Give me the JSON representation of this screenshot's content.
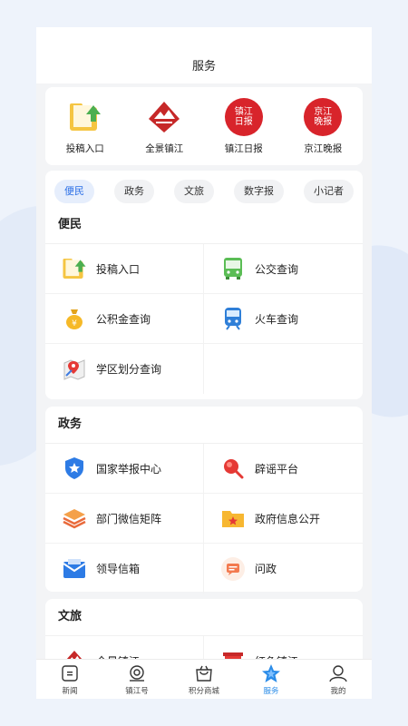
{
  "header": {
    "title": "服务"
  },
  "quick_links": [
    {
      "label": "投稿入口",
      "icon": "folder-upload-icon"
    },
    {
      "label": "全景镇江",
      "icon": "panorama-logo-icon"
    },
    {
      "label": "镇江日报",
      "icon": "zhenjiang-daily-logo",
      "logo_text": "镇江日报"
    },
    {
      "label": "京江晚报",
      "icon": "jingjiang-evening-logo",
      "logo_text": "京江晚报"
    }
  ],
  "filters": [
    {
      "label": "便民",
      "active": true
    },
    {
      "label": "政务",
      "active": false
    },
    {
      "label": "文旅",
      "active": false
    },
    {
      "label": "数字报",
      "active": false
    },
    {
      "label": "小记者",
      "active": false
    }
  ],
  "sections": {
    "bianmin": {
      "title": "便民",
      "items": [
        {
          "label": "投稿入口",
          "icon": "folder-upload-icon"
        },
        {
          "label": "公交查询",
          "icon": "bus-icon"
        },
        {
          "label": "公积金查询",
          "icon": "money-bag-icon"
        },
        {
          "label": "火车查询",
          "icon": "train-icon"
        },
        {
          "label": "学区划分查询",
          "icon": "map-pin-icon"
        }
      ]
    },
    "zhengwu": {
      "title": "政务",
      "items": [
        {
          "label": "国家举报中心",
          "icon": "shield-star-icon"
        },
        {
          "label": "辟谣平台",
          "icon": "magnifier-icon"
        },
        {
          "label": "部门微信矩阵",
          "icon": "layers-icon"
        },
        {
          "label": "政府信息公开",
          "icon": "folder-star-icon"
        },
        {
          "label": "领导信箱",
          "icon": "mail-icon"
        },
        {
          "label": "问政",
          "icon": "chat-icon"
        }
      ]
    },
    "wenlv": {
      "title": "文旅",
      "items": [
        {
          "label": "全景镇江",
          "icon": "panorama-logo-icon"
        },
        {
          "label": "红色镇江",
          "icon": "red-building-icon"
        }
      ]
    }
  },
  "tabbar": [
    {
      "label": "新闻",
      "icon": "news-icon",
      "active": false
    },
    {
      "label": "镇江号",
      "icon": "account-icon",
      "active": false
    },
    {
      "label": "积分商城",
      "icon": "shopping-bag-icon",
      "active": false
    },
    {
      "label": "服务",
      "icon": "star-icon",
      "active": true
    },
    {
      "label": "我的",
      "icon": "user-icon",
      "active": false
    }
  ],
  "colors": {
    "accent": "#2b6fe6",
    "brand_red": "#d8242b",
    "tab_active": "#2b8ce8"
  }
}
